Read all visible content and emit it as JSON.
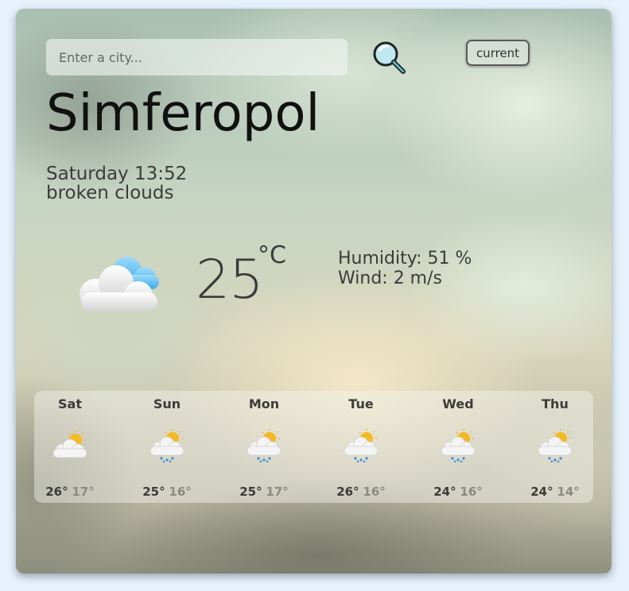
{
  "search": {
    "placeholder": "Enter a city..."
  },
  "toolbar": {
    "current_label": "current"
  },
  "location": {
    "city": "Simferopol"
  },
  "now": {
    "datetime": "Saturday 13:52",
    "description": "broken clouds",
    "temperature": "25",
    "unit": "°C",
    "humidity": "Humidity: 51 %",
    "wind": "Wind: 2 m/s",
    "icon": "cloud-icon"
  },
  "forecast": [
    {
      "day": "Sat",
      "high": "26°",
      "low": "17°",
      "icon": "partly-cloudy-icon"
    },
    {
      "day": "Sun",
      "high": "25°",
      "low": "16°",
      "icon": "partly-cloudy-rain-icon"
    },
    {
      "day": "Mon",
      "high": "25°",
      "low": "17°",
      "icon": "partly-cloudy-rain-icon"
    },
    {
      "day": "Tue",
      "high": "26°",
      "low": "16°",
      "icon": "partly-cloudy-rain-icon"
    },
    {
      "day": "Wed",
      "high": "24°",
      "low": "16°",
      "icon": "partly-cloudy-rain-icon"
    },
    {
      "day": "Thu",
      "high": "24°",
      "low": "14°",
      "icon": "partly-cloudy-rain-icon"
    }
  ],
  "colors": {
    "text": "#3b3b3b",
    "accent_sun": "#f5b921",
    "rain": "#3a8fd6",
    "cloud_blue": "#6bbcf2"
  }
}
